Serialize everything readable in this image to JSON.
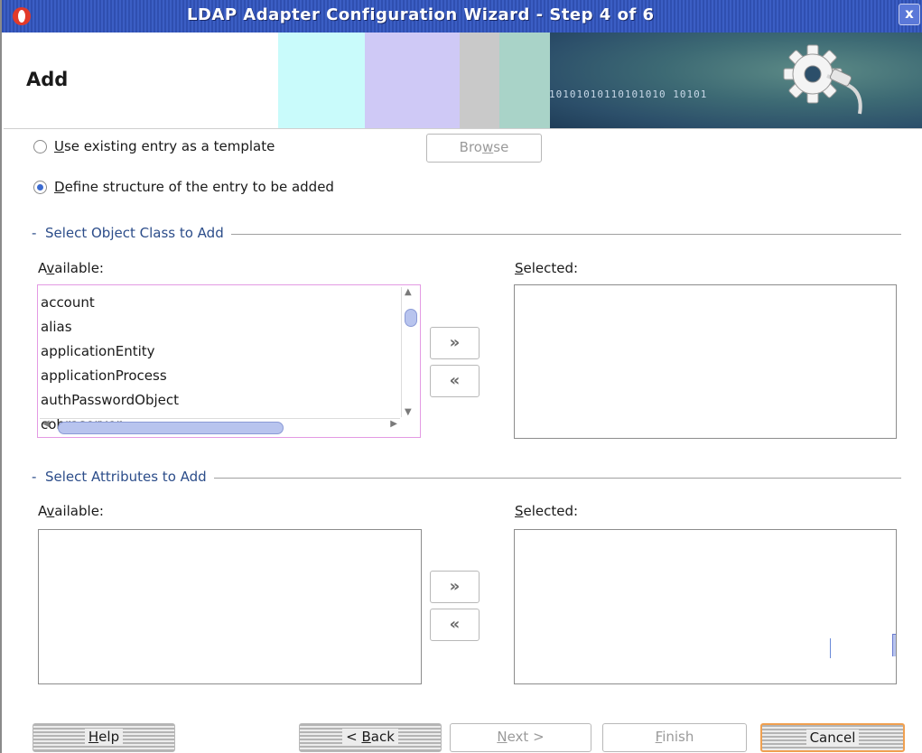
{
  "window": {
    "title": "LDAP Adapter Configuration Wizard - Step 4 of 6",
    "close_label": "x"
  },
  "header": {
    "title": "Add",
    "banner_bits": "10101010110101010  10101"
  },
  "template_options": {
    "use_existing_label_u": "U",
    "use_existing_label_rest": "se existing entry as a template",
    "use_existing_selected": false,
    "browse_label_pre": "Bro",
    "browse_label_u": "w",
    "browse_label_post": "se",
    "define_structure_label_u": "D",
    "define_structure_label_rest": "efine structure of the entry to be added",
    "define_structure_selected": true
  },
  "object_class_section": {
    "title": "Select Object Class to Add",
    "available_label_pre": "A",
    "available_label_u": "v",
    "available_label_post": "ailable:",
    "selected_label_u": "S",
    "selected_label_post": "elected:",
    "available_items": [
      "account",
      "alias",
      "applicationEntity",
      "applicationProcess",
      "authPasswordObject",
      "cobraserver"
    ],
    "selected_items": [],
    "add_button_glyph": "»",
    "remove_button_glyph": "«"
  },
  "attributes_section": {
    "title": "Select Attributes to Add",
    "available_label_pre": "A",
    "available_label_u": "v",
    "available_label_post": "ailable:",
    "selected_label_u": "S",
    "selected_label_post": "elected:",
    "available_items": [],
    "selected_items": [],
    "add_button_glyph": "»",
    "remove_button_glyph": "«"
  },
  "footer": {
    "help_u": "H",
    "help_rest": "elp",
    "back_pre": "< ",
    "back_u": "B",
    "back_post": "ack",
    "next_u": "N",
    "next_post": "ext >",
    "finish_u": "F",
    "finish_post": "inish",
    "cancel_label": "Cancel"
  },
  "colors": {
    "titlebar": "#3656bb",
    "section_title": "#2c4d8a",
    "radio_accent": "#3b6ad0",
    "default_button_border": "#f0a050"
  }
}
